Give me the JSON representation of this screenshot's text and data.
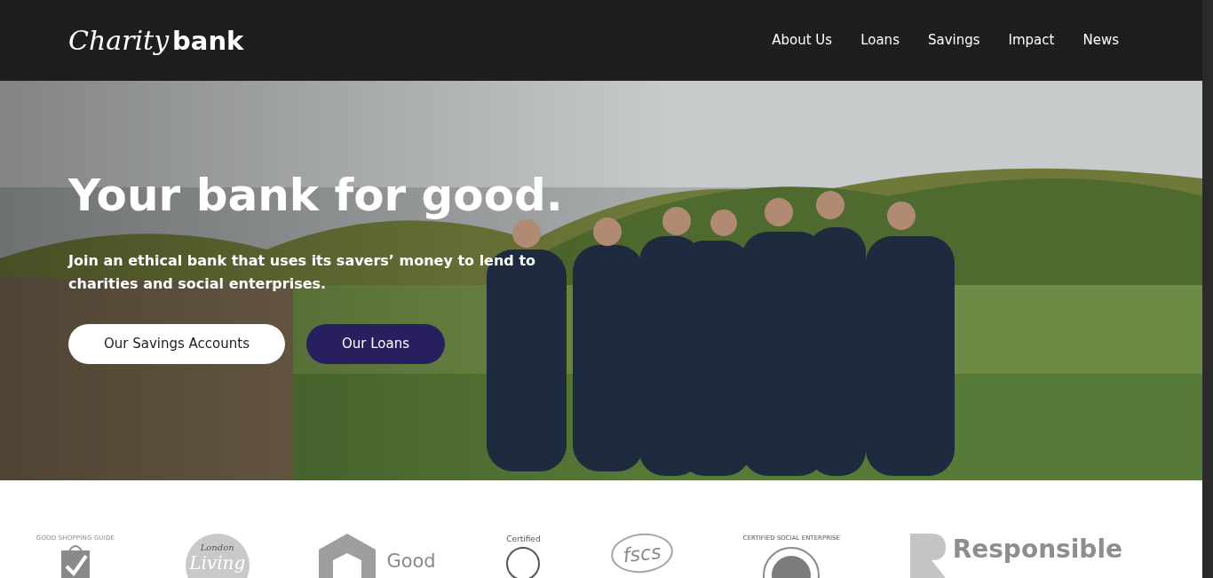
{
  "header": {
    "logo": {
      "script": "Charity",
      "word": "bank"
    },
    "nav": [
      {
        "label": "About Us"
      },
      {
        "label": "Loans"
      },
      {
        "label": "Savings"
      },
      {
        "label": "Impact"
      },
      {
        "label": "News"
      }
    ]
  },
  "hero": {
    "title": "Your bank for good.",
    "text": "Join an ethical bank that uses its savers’ money to lend to charities and social enterprises.",
    "buttons": [
      {
        "label": "Our Savings Accounts",
        "kind": "light"
      },
      {
        "label": "Our Loans",
        "kind": "dark"
      }
    ]
  },
  "partners": [
    {
      "kind": "shopping",
      "texts": [
        "GOOD SHOPPING GUIDE"
      ]
    },
    {
      "kind": "wage",
      "texts": [
        "London",
        "Living"
      ]
    },
    {
      "kind": "finance",
      "texts": [
        "Good"
      ]
    },
    {
      "kind": "bcorp",
      "texts": [
        "Certified"
      ]
    },
    {
      "kind": "fscs",
      "texts": [
        "fscs"
      ]
    },
    {
      "kind": "social",
      "texts": [
        "CERTIFIED SOCIAL ENTERPRISE"
      ]
    },
    {
      "kind": "responsible",
      "texts": [
        "Responsible"
      ]
    }
  ]
}
